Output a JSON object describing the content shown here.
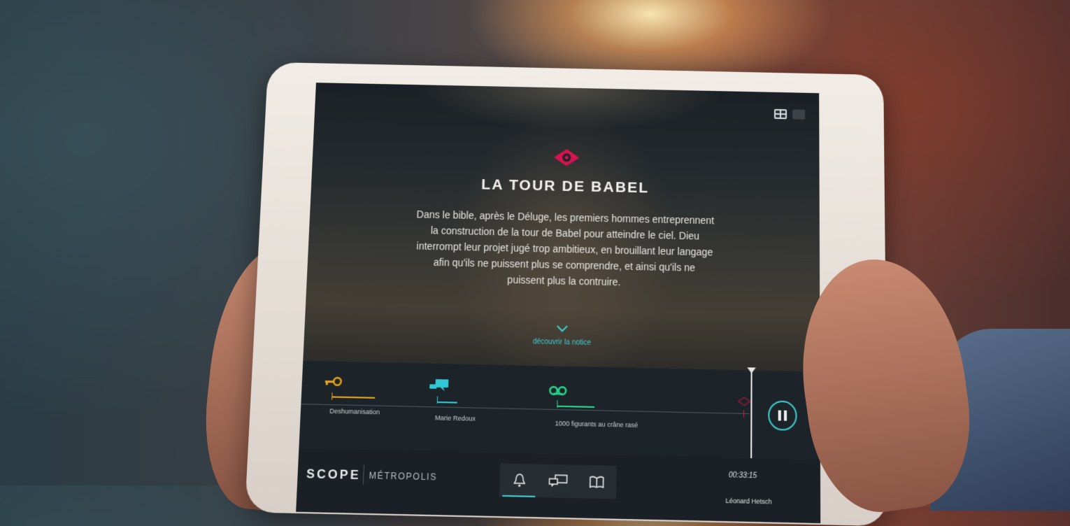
{
  "hero": {
    "title": "LA TOUR DE BABEL",
    "description": "Dans le bible, après le Déluge, les premiers hommes entreprennent la construction de la tour de Babel pour atteindre le ciel. Dieu interrompt leur projet jugé trop ambitieux, en brouillant leur langage afin qu'ils ne puissent plus se comprendre, et ainsi qu'ils ne puissent plus la contruire.",
    "discover_label": "découvrir la notice",
    "icon": "eye-icon",
    "accent_color": "#d5144f"
  },
  "view_toggle": {
    "options": [
      "grid-view-icon",
      "single-view-icon"
    ],
    "selected": "grid-view-icon"
  },
  "timeline": {
    "events": [
      {
        "label": "Deshumanisation",
        "icon": "key-icon",
        "color": "#e8a21a"
      },
      {
        "label": "Marie Redoux",
        "icon": "chat-icon",
        "color": "#2fc8d4"
      },
      {
        "label": "1000 figurants au crâne rasé",
        "icon": "tape-icon",
        "color": "#27d88a"
      },
      {
        "label": "",
        "icon": "eye-icon",
        "color": "#d5144f"
      }
    ],
    "play_state": "playing"
  },
  "footer": {
    "brand": "SCOPE",
    "subtitle": "MÉTROPOLIS",
    "time": "00:33:15",
    "author": "Léonard Hetsch",
    "tabs": [
      {
        "icon": "bell-icon",
        "active": true
      },
      {
        "icon": "chat-icon",
        "active": false
      },
      {
        "icon": "book-icon",
        "active": false
      }
    ],
    "accent_color": "#3ccbd0"
  }
}
